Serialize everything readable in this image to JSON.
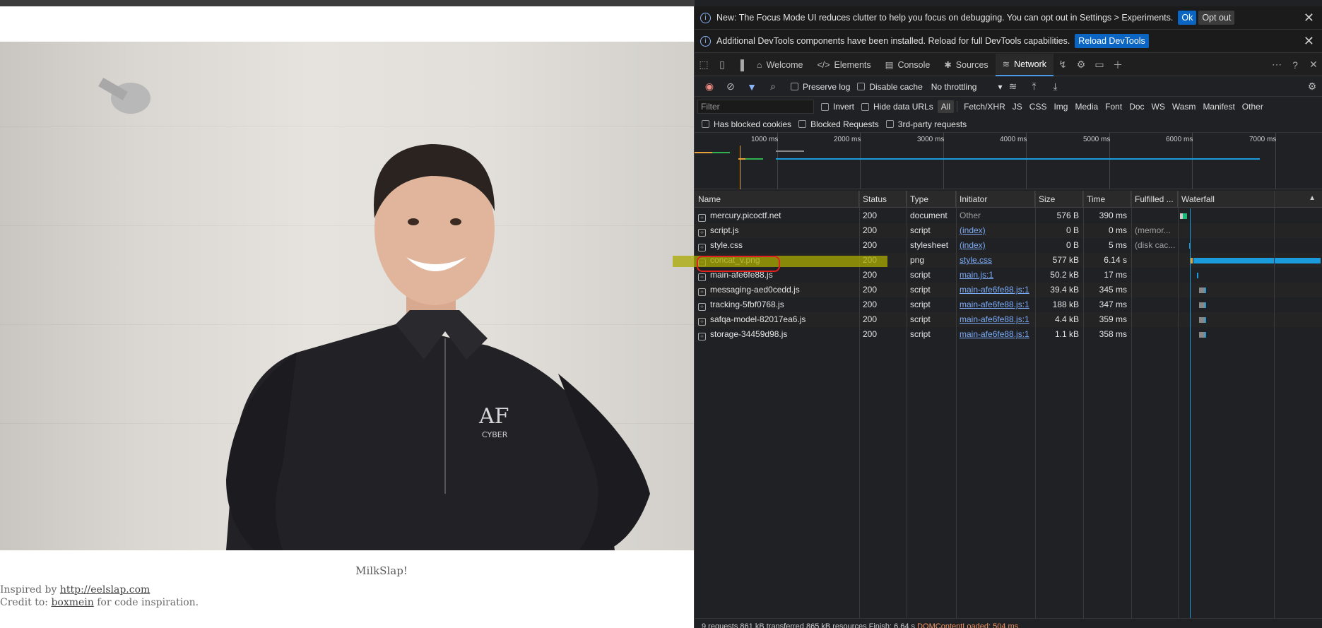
{
  "page": {
    "caption": "MilkSlap!",
    "inspired_prefix": "Inspired by ",
    "inspired_link": "http://eelslap.com",
    "credit_prefix": "Credit to: ",
    "credit_link": "boxmein",
    "credit_suffix": " for code inspiration."
  },
  "devtools": {
    "infobar1": {
      "text": "New: The Focus Mode UI reduces clutter to help you focus on debugging. You can opt out in Settings > Experiments.",
      "ok": "Ok",
      "opt_out": "Opt out"
    },
    "infobar2": {
      "text": "Additional DevTools components have been installed. Reload for full DevTools capabilities.",
      "reload": "Reload DevTools"
    },
    "tabs": [
      {
        "label": "Welcome",
        "icon": "home-icon"
      },
      {
        "label": "Elements",
        "icon": "code-icon"
      },
      {
        "label": "Console",
        "icon": "console-icon"
      },
      {
        "label": "Sources",
        "icon": "bug-icon"
      },
      {
        "label": "Network",
        "icon": "wifi-icon"
      }
    ],
    "toolbar": {
      "preserve_log": "Preserve log",
      "disable_cache": "Disable cache",
      "throttling": "No throttling"
    },
    "filter": {
      "placeholder": "Filter",
      "invert": "Invert",
      "hide_data_urls": "Hide data URLs",
      "types": [
        "All",
        "Fetch/XHR",
        "JS",
        "CSS",
        "Img",
        "Media",
        "Font",
        "Doc",
        "WS",
        "Wasm",
        "Manifest",
        "Other"
      ],
      "has_blocked_cookies": "Has blocked cookies",
      "blocked_requests": "Blocked Requests",
      "third_party": "3rd-party requests"
    },
    "overview_ticks": [
      "1000 ms",
      "2000 ms",
      "3000 ms",
      "4000 ms",
      "5000 ms",
      "6000 ms",
      "7000 ms"
    ],
    "columns": [
      "Name",
      "Status",
      "Type",
      "Initiator",
      "Size",
      "Time",
      "Fulfilled ...",
      "Waterfall"
    ],
    "rows": [
      {
        "name": "mercury.picoctf.net",
        "status": "200",
        "type": "document",
        "initiator": "Other",
        "size": "576 B",
        "time": "390 ms",
        "fulfilled": ""
      },
      {
        "name": "script.js",
        "status": "200",
        "type": "script",
        "initiator": "(index)",
        "size": "0 B",
        "time": "0 ms",
        "fulfilled": "(memor..."
      },
      {
        "name": "style.css",
        "status": "200",
        "type": "stylesheet",
        "initiator": "(index)",
        "size": "0 B",
        "time": "5 ms",
        "fulfilled": "(disk cac..."
      },
      {
        "name": "concat_v.png",
        "status": "200",
        "type": "png",
        "initiator": "style.css",
        "size": "577 kB",
        "time": "6.14 s",
        "fulfilled": ""
      },
      {
        "name": "main-afe6fe88.js",
        "status": "200",
        "type": "script",
        "initiator": "main.js:1",
        "size": "50.2 kB",
        "time": "17 ms",
        "fulfilled": ""
      },
      {
        "name": "messaging-aed0cedd.js",
        "status": "200",
        "type": "script",
        "initiator": "main-afe6fe88.js:1",
        "size": "39.4 kB",
        "time": "345 ms",
        "fulfilled": ""
      },
      {
        "name": "tracking-5fbf0768.js",
        "status": "200",
        "type": "script",
        "initiator": "main-afe6fe88.js:1",
        "size": "188 kB",
        "time": "347 ms",
        "fulfilled": ""
      },
      {
        "name": "safqa-model-82017ea6.js",
        "status": "200",
        "type": "script",
        "initiator": "main-afe6fe88.js:1",
        "size": "4.4 kB",
        "time": "359 ms",
        "fulfilled": ""
      },
      {
        "name": "storage-34459d98.js",
        "status": "200",
        "type": "script",
        "initiator": "main-afe6fe88.js:1",
        "size": "1.1 kB",
        "time": "358 ms",
        "fulfilled": ""
      }
    ],
    "status_bar": {
      "summary": "9 requests  861 kB transferred  865 kB resources  Finish: 6.64 s",
      "dom_loaded": "DOMContentLoaded: 504 ms"
    }
  }
}
